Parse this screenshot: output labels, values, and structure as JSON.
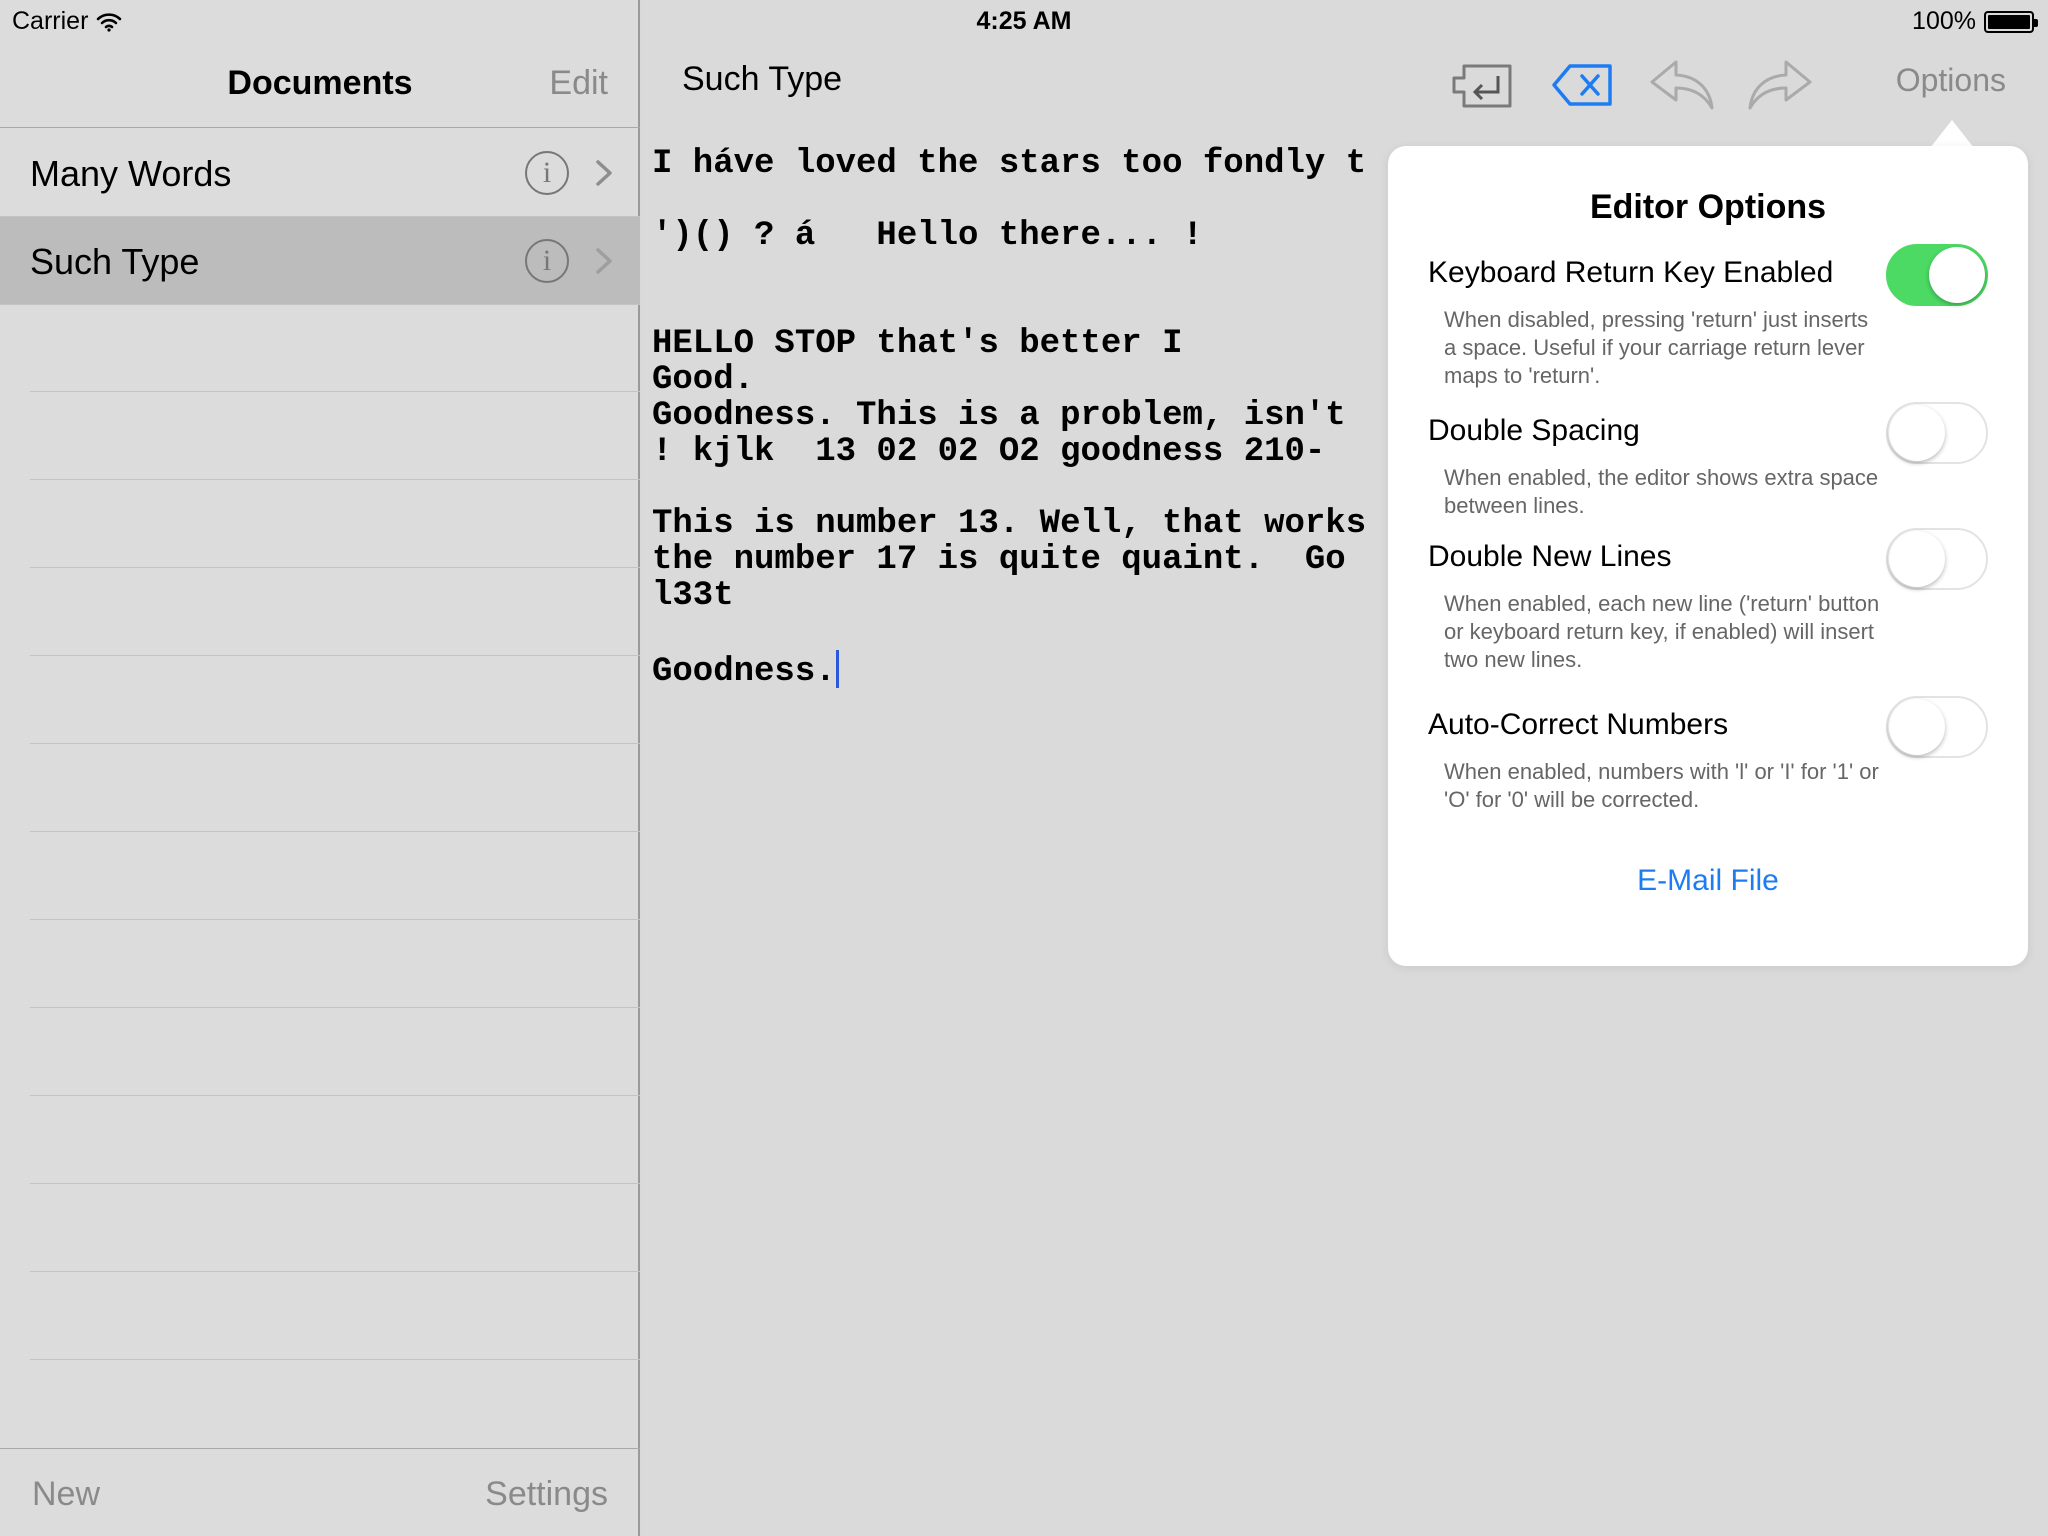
{
  "status": {
    "carrier": "Carrier",
    "time": "4:25 AM",
    "battery": "100%",
    "battery_level": 1.0
  },
  "sidebar": {
    "title": "Documents",
    "edit_label": "Edit",
    "documents": [
      {
        "name": "Many Words",
        "selected": false
      },
      {
        "name": "Such Type",
        "selected": true
      }
    ],
    "new_label": "New",
    "settings_label": "Settings"
  },
  "editor": {
    "title": "Such Type",
    "options_label": "Options",
    "icons": [
      "return-key-icon",
      "delete-key-icon",
      "undo-icon",
      "redo-icon"
    ],
    "text_lines": [
      "I háve loved the stars too fondly t",
      "",
      "')() ? á   Hello there... !",
      "",
      "",
      "HELLO STOP that's better I",
      "Good.",
      "Goodness. This is a problem, isn't",
      "! kjlk  13 02 02 O2 goodness 210-",
      "",
      "This is number 13. Well, that works",
      "the number 17 is quite quaint.  Go",
      "l33t",
      "",
      "Goodness."
    ]
  },
  "popover": {
    "title": "Editor Options",
    "options": [
      {
        "label": "Keyboard Return Key Enabled",
        "description": "When disabled, pressing 'return' just inserts a space.  Useful if your carriage return lever maps to 'return'.",
        "enabled": true
      },
      {
        "label": "Double Spacing",
        "description": "When enabled, the editor shows extra space between lines.",
        "enabled": false
      },
      {
        "label": "Double New Lines",
        "description": "When enabled, each new line ('return' button or keyboard return key, if enabled) will insert two new lines.",
        "enabled": false
      },
      {
        "label": "Auto-Correct Numbers",
        "description": "When enabled, numbers with 'l' or 'I' for '1' or 'O' for '0' will be corrected.",
        "enabled": false
      }
    ],
    "email_label": "E-Mail File"
  },
  "colors": {
    "accent": "#1d7cf2",
    "toggle_on": "#4cd964",
    "cursor": "#2b58d6"
  }
}
